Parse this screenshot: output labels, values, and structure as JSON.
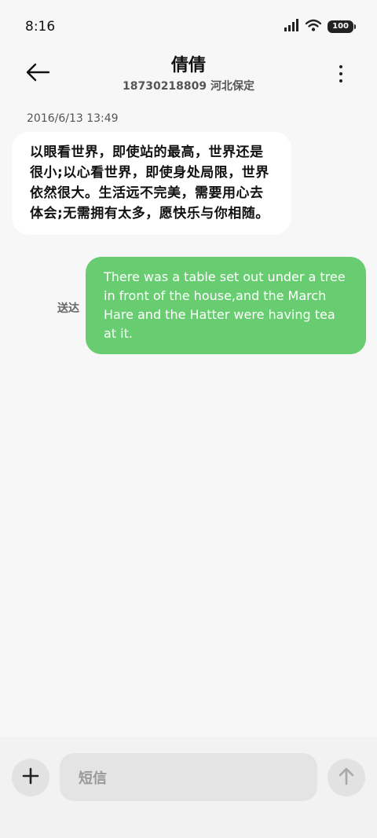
{
  "status_bar": {
    "time": "8:16",
    "battery": "100",
    "icons": [
      "signal-icon",
      "wifi-icon",
      "battery-icon"
    ]
  },
  "header": {
    "back_icon": "arrow-left-icon",
    "contact_name": "倩倩",
    "contact_subtitle": "18730218809 河北保定",
    "more_icon": "more-vertical-icon"
  },
  "conversation": {
    "timestamp": "2016/6/13 13:49",
    "messages": [
      {
        "direction": "incoming",
        "text": "以眼看世界，即使站的最高，世界还是很小;以心看世界，即使身处局限，世界依然很大。生活远不完美，需要用心去体会;无需拥有太多，愿快乐与你相随。"
      },
      {
        "direction": "outgoing",
        "text": "There was a table set out under a tree in front of the house,and the March Hare and the Hatter were having tea at it.",
        "status": "送达"
      }
    ]
  },
  "compose": {
    "add_icon": "plus-icon",
    "placeholder": "短信",
    "send_icon": "arrow-up-icon"
  },
  "colors": {
    "outgoing_bubble": "#67cd70",
    "incoming_bubble": "#ffffff",
    "background": "#f7f7f7"
  }
}
